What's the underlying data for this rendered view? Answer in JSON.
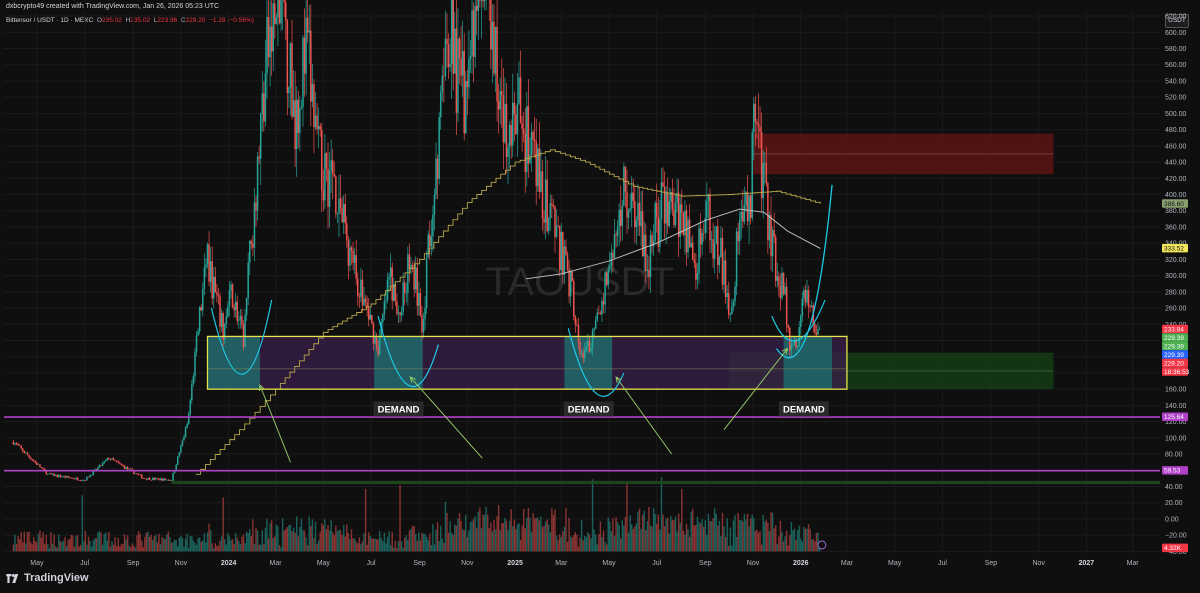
{
  "header": {
    "credit": "dxbcrypto49 created with TradingView.com, Jan 26, 2026 05:23 UTC",
    "symbol": "Bittensor / USDT · 1D · MEXC",
    "o_label": "O",
    "o_value": "235.02",
    "h_label": "H",
    "h_value": "235.02",
    "l_label": "L",
    "l_value": "223.96",
    "c_label": "C",
    "c_value": "229.20",
    "change": "−1.28 (−0.56%)",
    "currency": "USDT"
  },
  "watermark": "TAOUSDT",
  "brand": "TradingView",
  "colors": {
    "bull": "#26a69a",
    "bear": "#ef5350",
    "purple_line": "#b040c8",
    "yellow_box": "#e7e34a",
    "supply_zone": "#5a1414",
    "demand_zone": "#143a14",
    "cyan_arc": "#1ec8e6",
    "green_arrow": "#9cd36a"
  },
  "chart_data": {
    "type": "candlestick",
    "title": "Bittensor / USDT · 1D · MEXC",
    "y_axis": {
      "ticks": [
        "620.00",
        "600.00",
        "580.00",
        "560.00",
        "540.00",
        "520.00",
        "500.00",
        "480.00",
        "460.00",
        "440.00",
        "420.00",
        "400.00",
        "380.00",
        "360.00",
        "340.00",
        "320.00",
        "300.00",
        "280.00",
        "260.00",
        "240.00",
        "220.00",
        "200.00",
        "180.00",
        "160.00",
        "140.00",
        "120.00",
        "100.00",
        "80.00",
        "60.00",
        "40.00",
        "20.00",
        "0.00",
        "−20.00",
        "−40.00"
      ],
      "ylim": [
        -40,
        620
      ]
    },
    "x_axis": {
      "ticks": [
        {
          "label": "May",
          "year": false
        },
        {
          "label": "Jul",
          "year": false
        },
        {
          "label": "Sep",
          "year": false
        },
        {
          "label": "Nov",
          "year": false
        },
        {
          "label": "2024",
          "year": true
        },
        {
          "label": "Mar",
          "year": false
        },
        {
          "label": "May",
          "year": false
        },
        {
          "label": "Jul",
          "year": false
        },
        {
          "label": "Sep",
          "year": false
        },
        {
          "label": "Nov",
          "year": false
        },
        {
          "label": "2025",
          "year": true
        },
        {
          "label": "Mar",
          "year": false
        },
        {
          "label": "May",
          "year": false
        },
        {
          "label": "Jul",
          "year": false
        },
        {
          "label": "Sep",
          "year": false
        },
        {
          "label": "Nov",
          "year": false
        },
        {
          "label": "2026",
          "year": true
        },
        {
          "label": "Mar",
          "year": false
        },
        {
          "label": "May",
          "year": false
        },
        {
          "label": "Jul",
          "year": false
        },
        {
          "label": "Sep",
          "year": false
        },
        {
          "label": "Nov",
          "year": false
        },
        {
          "label": "2027",
          "year": true
        },
        {
          "label": "Mar",
          "year": false
        }
      ]
    },
    "price_path": [
      [
        "2023-04-01",
        95
      ],
      [
        "2023-05-15",
        55
      ],
      [
        "2023-07-01",
        48
      ],
      [
        "2023-08-01",
        75
      ],
      [
        "2023-09-15",
        50
      ],
      [
        "2023-10-20",
        48
      ],
      [
        "2023-11-10",
        120
      ],
      [
        "2023-11-25",
        250
      ],
      [
        "2023-12-05",
        320
      ],
      [
        "2023-12-25",
        230
      ],
      [
        "2024-01-05",
        280
      ],
      [
        "2024-01-20",
        220
      ],
      [
        "2024-02-05",
        420
      ],
      [
        "2024-02-20",
        580
      ],
      [
        "2024-03-10",
        640
      ],
      [
        "2024-03-25",
        500
      ],
      [
        "2024-04-10",
        580
      ],
      [
        "2024-04-25",
        440
      ],
      [
        "2024-05-15",
        420
      ],
      [
        "2024-06-05",
        320
      ],
      [
        "2024-06-25",
        260
      ],
      [
        "2024-07-10",
        210
      ],
      [
        "2024-07-25",
        300
      ],
      [
        "2024-08-05",
        245
      ],
      [
        "2024-08-20",
        330
      ],
      [
        "2024-09-05",
        240
      ],
      [
        "2024-09-20",
        420
      ],
      [
        "2024-10-10",
        600
      ],
      [
        "2024-10-25",
        520
      ],
      [
        "2024-11-05",
        560
      ],
      [
        "2024-11-20",
        650
      ],
      [
        "2024-12-05",
        580
      ],
      [
        "2024-12-20",
        460
      ],
      [
        "2025-01-05",
        500
      ],
      [
        "2025-01-25",
        440
      ],
      [
        "2025-02-10",
        380
      ],
      [
        "2025-02-25",
        340
      ],
      [
        "2025-03-15",
        280
      ],
      [
        "2025-03-25",
        200
      ],
      [
        "2025-04-10",
        220
      ],
      [
        "2025-04-20",
        260
      ],
      [
        "2025-05-05",
        330
      ],
      [
        "2025-05-20",
        420
      ],
      [
        "2025-06-05",
        380
      ],
      [
        "2025-06-20",
        320
      ],
      [
        "2025-07-05",
        380
      ],
      [
        "2025-07-20",
        410
      ],
      [
        "2025-08-05",
        360
      ],
      [
        "2025-08-20",
        320
      ],
      [
        "2025-09-05",
        370
      ],
      [
        "2025-09-20",
        330
      ],
      [
        "2025-10-05",
        250
      ],
      [
        "2025-10-15",
        380
      ],
      [
        "2025-10-28",
        390
      ],
      [
        "2025-11-05",
        540
      ],
      [
        "2025-11-12",
        420
      ],
      [
        "2025-11-20",
        380
      ],
      [
        "2025-12-01",
        300
      ],
      [
        "2025-12-10",
        290
      ],
      [
        "2025-12-18",
        210
      ],
      [
        "2025-12-28",
        215
      ],
      [
        "2026-01-05",
        280
      ],
      [
        "2026-01-12",
        265
      ],
      [
        "2026-01-20",
        240
      ],
      [
        "2026-01-26",
        229.2
      ]
    ],
    "ma_long": [
      [
        "2023-11-20",
        55
      ],
      [
        "2024-01-15",
        110
      ],
      [
        "2024-03-01",
        160
      ],
      [
        "2024-05-01",
        230
      ],
      [
        "2024-07-01",
        265
      ],
      [
        "2024-09-01",
        320
      ],
      [
        "2024-11-01",
        390
      ],
      [
        "2025-01-01",
        440
      ],
      [
        "2025-02-15",
        455
      ],
      [
        "2025-04-01",
        440
      ],
      [
        "2025-06-01",
        410
      ],
      [
        "2025-08-01",
        398
      ],
      [
        "2025-10-01",
        400
      ],
      [
        "2025-12-01",
        404
      ],
      [
        "2026-01-26",
        388.6
      ]
    ],
    "ma_short": [
      [
        "2025-01-15",
        296
      ],
      [
        "2025-03-01",
        302
      ],
      [
        "2025-05-01",
        318
      ],
      [
        "2025-07-01",
        340
      ],
      [
        "2025-09-01",
        368
      ],
      [
        "2025-10-15",
        382
      ],
      [
        "2025-11-15",
        378
      ],
      [
        "2025-12-15",
        355
      ],
      [
        "2026-01-26",
        333.52
      ]
    ],
    "horizontal_lines": [
      {
        "value": 125.64,
        "color": "#b040c8"
      },
      {
        "value": 59.53,
        "color": "#b040c8"
      }
    ],
    "price_tags": [
      {
        "value": 388.6,
        "label": "388.60",
        "bg": "#8aa070",
        "fg": "#111111"
      },
      {
        "value": 333.52,
        "label": "333.52",
        "bg": "#f2e75c",
        "fg": "#111111"
      },
      {
        "value": 233.84,
        "label": "233.84",
        "bg": "#f23645",
        "fg": "#ffffff"
      },
      {
        "value": 229.39,
        "label": "229.39",
        "bg": "#4caf50",
        "fg": "#ffffff"
      },
      {
        "value": 229.39,
        "label": "229.39",
        "bg": "#4caf50",
        "fg": "#ffffff"
      },
      {
        "value": 229.39,
        "label": "229.39",
        "bg": "#2962ff",
        "fg": "#ffffff"
      },
      {
        "value": 229.2,
        "label": "229.20",
        "bg": "#f23645",
        "fg": "#ffffff"
      },
      {
        "value": 229.2,
        "label": "18:36:53",
        "bg": "#f23645",
        "fg": "#ffffff"
      },
      {
        "value": 125.64,
        "label": "125.64",
        "bg": "#b040c8",
        "fg": "#ffffff"
      },
      {
        "value": 59.53,
        "label": "59.53",
        "bg": "#b040c8",
        "fg": "#ffffff"
      },
      {
        "value": -36,
        "label": "4.32K",
        "bg": "#f23645",
        "fg": "#ffffff"
      }
    ],
    "zones": [
      {
        "kind": "supply",
        "from": "2025-11-01",
        "to": "2026-11-20",
        "low": 425,
        "high": 475
      },
      {
        "kind": "demand",
        "from": "2025-10-01",
        "to": "2026-11-20",
        "low": 160,
        "high": 205
      },
      {
        "kind": "range_box",
        "from": "2023-12-05",
        "to": "2026-03-01",
        "low": 160,
        "high": 225
      }
    ],
    "highlight_boxes": [
      {
        "from": "2023-12-05",
        "to": "2024-02-10"
      },
      {
        "from": "2024-07-05",
        "to": "2024-09-05"
      },
      {
        "from": "2025-03-05",
        "to": "2025-05-05"
      },
      {
        "from": "2025-12-10",
        "to": "2026-02-10"
      }
    ],
    "labels": [
      {
        "text": "DEMAND",
        "date": "2024-08-05",
        "value": 135
      },
      {
        "text": "DEMAND",
        "date": "2025-04-05",
        "value": 135
      },
      {
        "text": "DEMAND",
        "date": "2026-01-05",
        "value": 135
      }
    ]
  }
}
